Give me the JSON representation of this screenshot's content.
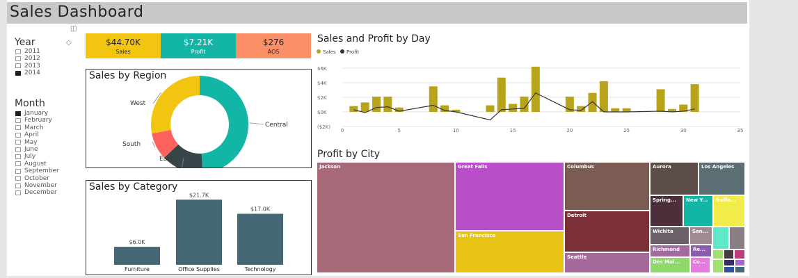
{
  "title": "Sales Dashboard",
  "year_slicer": {
    "title": "Year",
    "items": [
      "2011",
      "2012",
      "2013",
      "2014"
    ],
    "selected": [
      "2014"
    ]
  },
  "month_slicer": {
    "title": "Month",
    "items": [
      "January",
      "February",
      "March",
      "April",
      "May",
      "June",
      "July",
      "August",
      "September",
      "October",
      "November",
      "December"
    ],
    "selected": [
      "January"
    ]
  },
  "kpis": [
    {
      "value": "$44.70K",
      "label": "Sales",
      "color": "#f2c511",
      "text_color": "#222222"
    },
    {
      "value": "$7.21K",
      "label": "Profit",
      "color": "#12b5a6",
      "text_color": "#ffffff"
    },
    {
      "value": "$276",
      "label": "AOS",
      "color": "#fb8f67",
      "text_color": "#222222"
    }
  ],
  "region_panel": {
    "title": "Sales by Region"
  },
  "category_panel": {
    "title": "Sales by Category"
  },
  "day_panel": {
    "title": "Sales and Profit by Day"
  },
  "city_panel": {
    "title": "Profit by City"
  },
  "chart_data": [
    {
      "type": "pie",
      "title": "Sales by Region",
      "donut": true,
      "categories": [
        "Central",
        "East",
        "South",
        "West"
      ],
      "values": [
        49,
        14,
        9,
        28
      ],
      "colors": [
        "#12b5a6",
        "#374649",
        "#fd625e",
        "#f2c511"
      ],
      "labels": [
        "Central",
        "East",
        "South",
        "West"
      ]
    },
    {
      "type": "bar",
      "title": "Sales by Category",
      "categories": [
        "Furniture",
        "Office Supplies",
        "Technology"
      ],
      "values": [
        6.0,
        21.7,
        17.0
      ],
      "data_labels": [
        "$6.0K",
        "$21.7K",
        "$17.0K"
      ],
      "color": "#466874",
      "ylim": [
        0,
        22
      ]
    },
    {
      "type": "bar",
      "title": "Sales and Profit by Day",
      "legend_position": "top-left",
      "series": [
        {
          "name": "Sales",
          "type": "bar",
          "color": "#b8a41a",
          "x": [
            1,
            2,
            3,
            4,
            5,
            8,
            9,
            10,
            13,
            14,
            15,
            16,
            17,
            20,
            21,
            22,
            23,
            24,
            25,
            28,
            29,
            30,
            31
          ],
          "values": [
            0.8,
            1.3,
            2.1,
            2.1,
            0.6,
            3.5,
            0.9,
            0.3,
            0.9,
            4.7,
            1.1,
            2.1,
            6.2,
            2.1,
            0.8,
            2.6,
            4.2,
            0.5,
            0.5,
            3.1,
            0.4,
            1.0,
            3.8
          ]
        },
        {
          "name": "Profit",
          "type": "line",
          "color": "#333333",
          "x": [
            1,
            2,
            3,
            4,
            5,
            8,
            9,
            10,
            13,
            14,
            15,
            16,
            17,
            20,
            21,
            22,
            23,
            24,
            25,
            28,
            29,
            30,
            31
          ],
          "values": [
            0.3,
            -0.1,
            0.6,
            0.7,
            0.1,
            0.9,
            0.2,
            0.0,
            -1.1,
            0.3,
            0.4,
            0.5,
            2.6,
            0.3,
            0.2,
            1.4,
            0.0,
            0.0,
            0.0,
            0.1,
            0.0,
            0.1,
            0.4
          ]
        }
      ],
      "xlim": [
        0,
        35
      ],
      "xticks": [
        0,
        5,
        10,
        15,
        20,
        25,
        30,
        35
      ],
      "ylim": [
        -2,
        6
      ],
      "yticks": [
        -2,
        0,
        2,
        4,
        6
      ],
      "ytick_labels": [
        "($2K)",
        "$0K",
        "$2K",
        "$4K",
        "$6K"
      ],
      "grid": true
    },
    {
      "type": "treemap",
      "title": "Profit by City",
      "cells": [
        {
          "name": "Jackson",
          "color": "#a66977"
        },
        {
          "name": "Great Falls",
          "color": "#b94ec9"
        },
        {
          "name": "San Francisco",
          "color": "#e6c315"
        },
        {
          "name": "Columbus",
          "color": "#7a5c52"
        },
        {
          "name": "Detroit",
          "color": "#7a3036"
        },
        {
          "name": "Seattle",
          "color": "#a56a9c"
        },
        {
          "name": "Aurora",
          "color": "#5c4d48"
        },
        {
          "name": "Los Angeles",
          "color": "#5a6e73"
        },
        {
          "name": "Spring...",
          "color": "#4c2f3a"
        },
        {
          "name": "New Y...",
          "color": "#12b5a6"
        },
        {
          "name": "Buffa...",
          "color": "#f2ec4a"
        },
        {
          "name": "Wichita",
          "color": "#6c6068"
        },
        {
          "name": "San...",
          "color": "#a08a92"
        },
        {
          "name": "Richmond",
          "color": "#a26aa0"
        },
        {
          "name": "Re...",
          "color": "#8a5bb0"
        },
        {
          "name": "Des Moi...",
          "color": "#90d86c"
        },
        {
          "name": "Co...",
          "color": "#e87ae0"
        }
      ]
    }
  ]
}
